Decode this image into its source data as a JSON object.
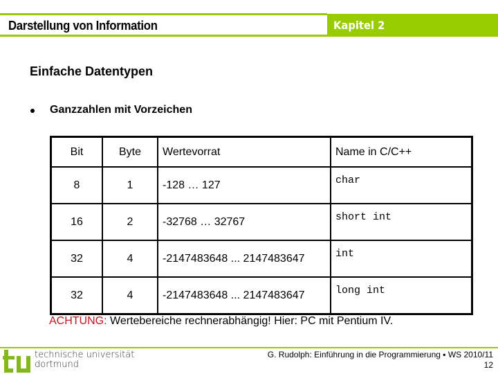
{
  "header": {
    "title": "Darstellung von Information",
    "chapter": "Kapitel 2",
    "accent_color": "#99cc00"
  },
  "section": {
    "heading": "Einfache Datentypen",
    "bullet": "Ganzzahlen mit Vorzeichen"
  },
  "table": {
    "columns": [
      "Bit",
      "Byte",
      "Wertevorrat",
      "Name in C/C++"
    ],
    "rows": [
      {
        "bit": "8",
        "byte": "1",
        "range": "-128 … 127",
        "name": "char"
      },
      {
        "bit": "16",
        "byte": "2",
        "range": "-32768 … 32767",
        "name": "short int"
      },
      {
        "bit": "32",
        "byte": "4",
        "range": "-2147483648 ... 2147483647",
        "name": "int"
      },
      {
        "bit": "32",
        "byte": "4",
        "range": "-2147483648 ... 2147483647",
        "name": "long int"
      }
    ]
  },
  "warning": {
    "label": "ACHTUNG:",
    "text": " Wertebereiche rechnerabhängig! Hier: PC mit Pentium IV.",
    "label_color": "#c0141e"
  },
  "footer": {
    "logo_line1": "technische universität",
    "logo_line2": "dortmund",
    "credit": "G. Rudolph: Einführung in die Programmierung ▪ WS 2010/11",
    "page": "12"
  }
}
